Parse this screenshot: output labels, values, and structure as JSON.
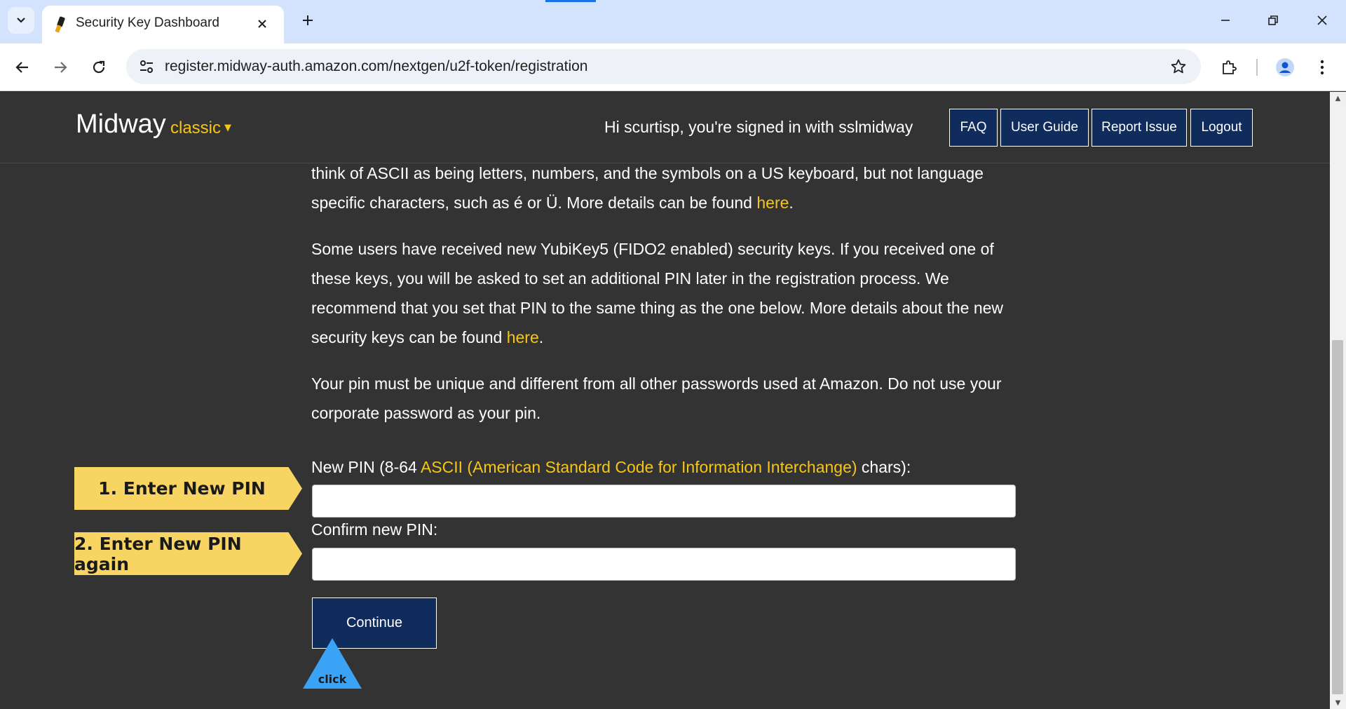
{
  "browser": {
    "tab_title": "Security Key Dashboard",
    "url": "register.midway-auth.amazon.com/nextgen/u2f-token/registration"
  },
  "header": {
    "logo": "Midway",
    "logo_sub": "classic",
    "caret": "▼",
    "greeting": "Hi scurtisp, you're signed in with sslmidway",
    "buttons": {
      "faq": "FAQ",
      "user_guide": "User Guide",
      "report_issue": "Report Issue",
      "logout": "Logout"
    }
  },
  "content": {
    "p1_text": "think of ASCII as being letters, numbers, and the symbols on a US keyboard, but not language specific characters, such as é or Ü. More details can be found ",
    "p1_link": "here",
    "p1_end": ".",
    "p2_text": "Some users have received new YubiKey5 (FIDO2 enabled) security keys. If you received one of these keys, you will be asked to set an additional PIN later in the registration process. We recommend that you set that PIN to the same thing as the one below. More details about the new security keys can be found ",
    "p2_link": "here",
    "p2_end": ".",
    "p3_text": "Your pin must be unique and different from all other passwords used at Amazon. Do not use your corporate password as your pin."
  },
  "form": {
    "new_pin_label_start": "New PIN (8-64 ",
    "new_pin_label_link": "ASCII (American Standard Code for Information Interchange)",
    "new_pin_label_end": " chars):",
    "new_pin_value": "",
    "confirm_label": "Confirm new PIN:",
    "confirm_value": "",
    "continue_label": "Continue"
  },
  "annotations": {
    "step1": "1.  Enter New PIN",
    "step2": "2.  Enter New PIN again",
    "click": "click"
  },
  "colors": {
    "page_bg": "#333333",
    "accent_link": "#f5c518",
    "button_navy": "#0f2c5c",
    "callout_yellow": "#f8d562",
    "click_blue": "#3ba3f5"
  }
}
